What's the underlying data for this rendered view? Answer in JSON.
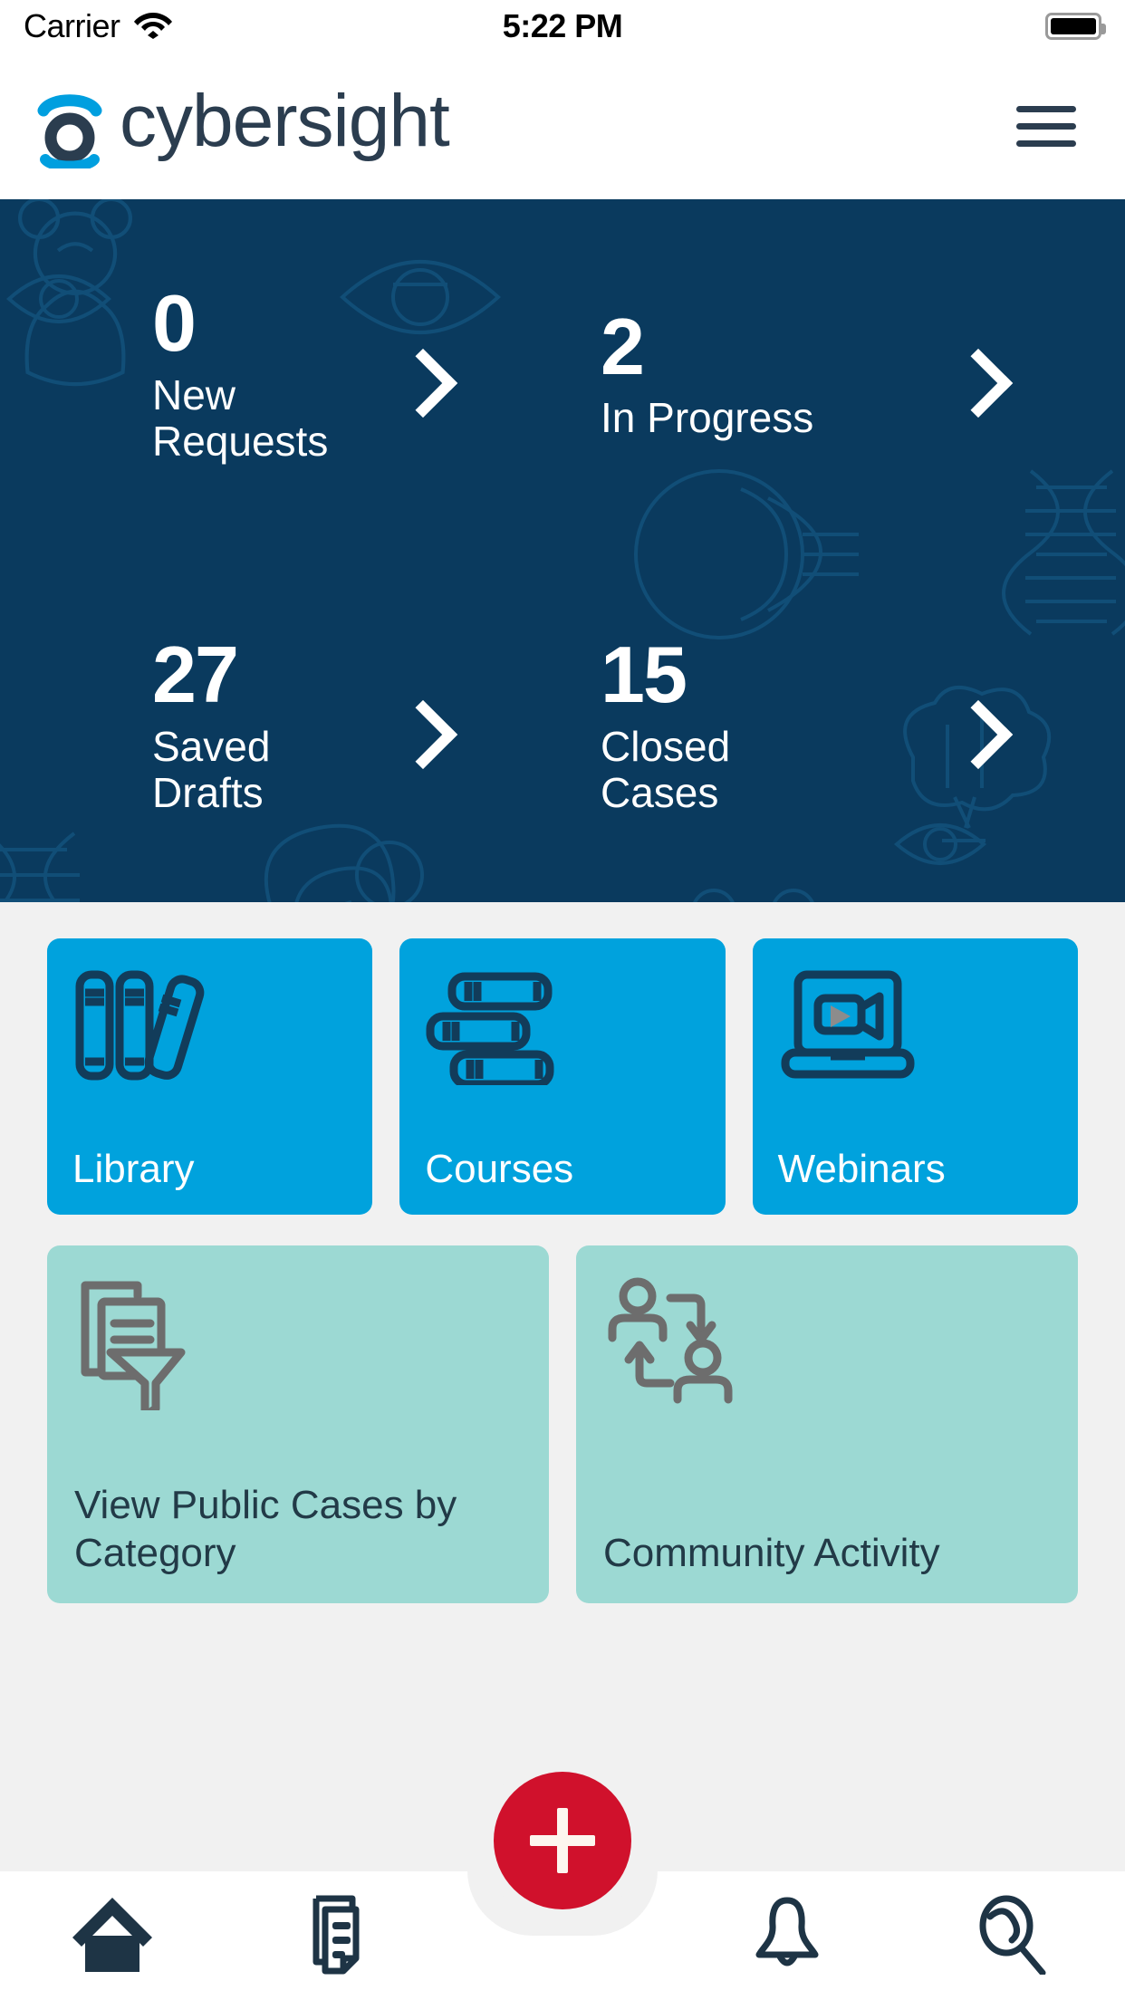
{
  "status_bar": {
    "carrier": "Carrier",
    "time": "5:22 PM",
    "wifi_icon": "wifi-icon",
    "battery_icon": "battery-full-icon"
  },
  "header": {
    "brand_name": "cybersight",
    "logo_icon": "cybersight-eye-logo-icon",
    "menu_icon": "hamburger-menu-icon",
    "brand_colors": {
      "arc": "#009fdf",
      "ring": "#2b3d4f",
      "wordmark": "#2b3d4f"
    }
  },
  "hero": {
    "background_color": "#0a3a5e",
    "watermark_icons": [
      "eye-icon",
      "eye-anatomy-icon",
      "dna-helix-icon",
      "brain-icon",
      "teddy-bear-icon",
      "cornea-icon"
    ],
    "stats": [
      {
        "value": "0",
        "label": "New\nRequests",
        "chevron_icon": "chevron-right-icon"
      },
      {
        "value": "2",
        "label": "In Progress",
        "chevron_icon": "chevron-right-icon"
      },
      {
        "value": "27",
        "label": "Saved\nDrafts",
        "chevron_icon": "chevron-right-icon"
      },
      {
        "value": "15",
        "label": "Closed\nCases",
        "chevron_icon": "chevron-right-icon"
      }
    ]
  },
  "quick_links": {
    "blue_color": "#00a2dd",
    "teal_color": "#9cd9d3",
    "primary": [
      {
        "label": "Library",
        "icon": "books-upright-icon"
      },
      {
        "label": "Courses",
        "icon": "books-stacked-icon"
      },
      {
        "label": "Webinars",
        "icon": "laptop-video-icon"
      }
    ],
    "secondary": [
      {
        "label": "View Public Cases by Category",
        "icon": "documents-filter-icon"
      },
      {
        "label": "Community Activity",
        "icon": "people-exchange-icon"
      }
    ]
  },
  "bottom_nav": {
    "fab": {
      "icon": "plus-icon",
      "color": "#d0112c"
    },
    "items": [
      {
        "name": "home",
        "icon": "home-icon",
        "active": true
      },
      {
        "name": "cases",
        "icon": "documents-icon",
        "active": false
      },
      {
        "name": "notifications",
        "icon": "bell-icon",
        "active": false
      },
      {
        "name": "search",
        "icon": "magnifier-icon",
        "active": false
      }
    ]
  }
}
